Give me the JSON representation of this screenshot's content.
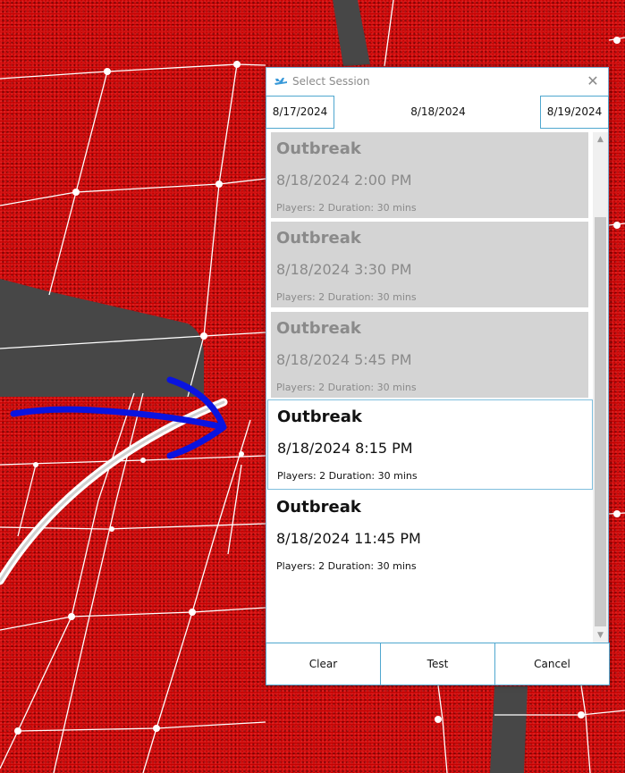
{
  "window": {
    "title": "Select Session",
    "close_glyph": "✕"
  },
  "date_nav": {
    "previous": "8/17/2024",
    "current": "8/18/2024",
    "next": "8/19/2024"
  },
  "sessions": [
    {
      "name": "Outbreak",
      "time": "8/18/2024 2:00 PM",
      "meta": "Players: 2 Duration: 30 mins",
      "state": "past"
    },
    {
      "name": "Outbreak",
      "time": "8/18/2024 3:30 PM",
      "meta": "Players: 2 Duration: 30 mins",
      "state": "past"
    },
    {
      "name": "Outbreak",
      "time": "8/18/2024 5:45 PM",
      "meta": "Players: 2 Duration: 30 mins",
      "state": "past"
    },
    {
      "name": "Outbreak",
      "time": "8/18/2024 8:15 PM",
      "meta": "Players: 2 Duration: 30 mins",
      "state": "selected"
    },
    {
      "name": "Outbreak",
      "time": "8/18/2024 11:45 PM",
      "meta": "Players: 2 Duration: 30 mins",
      "state": "future"
    }
  ],
  "footer": {
    "clear": "Clear",
    "test": "Test",
    "cancel": "Cancel"
  },
  "scrollbar": {
    "up_glyph": "▲",
    "down_glyph": "▼"
  },
  "icons": {
    "app": "airplane-icon",
    "close": "close-icon",
    "annotation": "blue-arrow-annotation"
  },
  "colors": {
    "background_red": "#c40000",
    "grid_line": "#ffffff",
    "shadow_shape": "#474747",
    "annotation_blue": "#0a14e0",
    "dialog_border": "#4fa7cf",
    "past_session_bg": "#d4d4d4"
  }
}
